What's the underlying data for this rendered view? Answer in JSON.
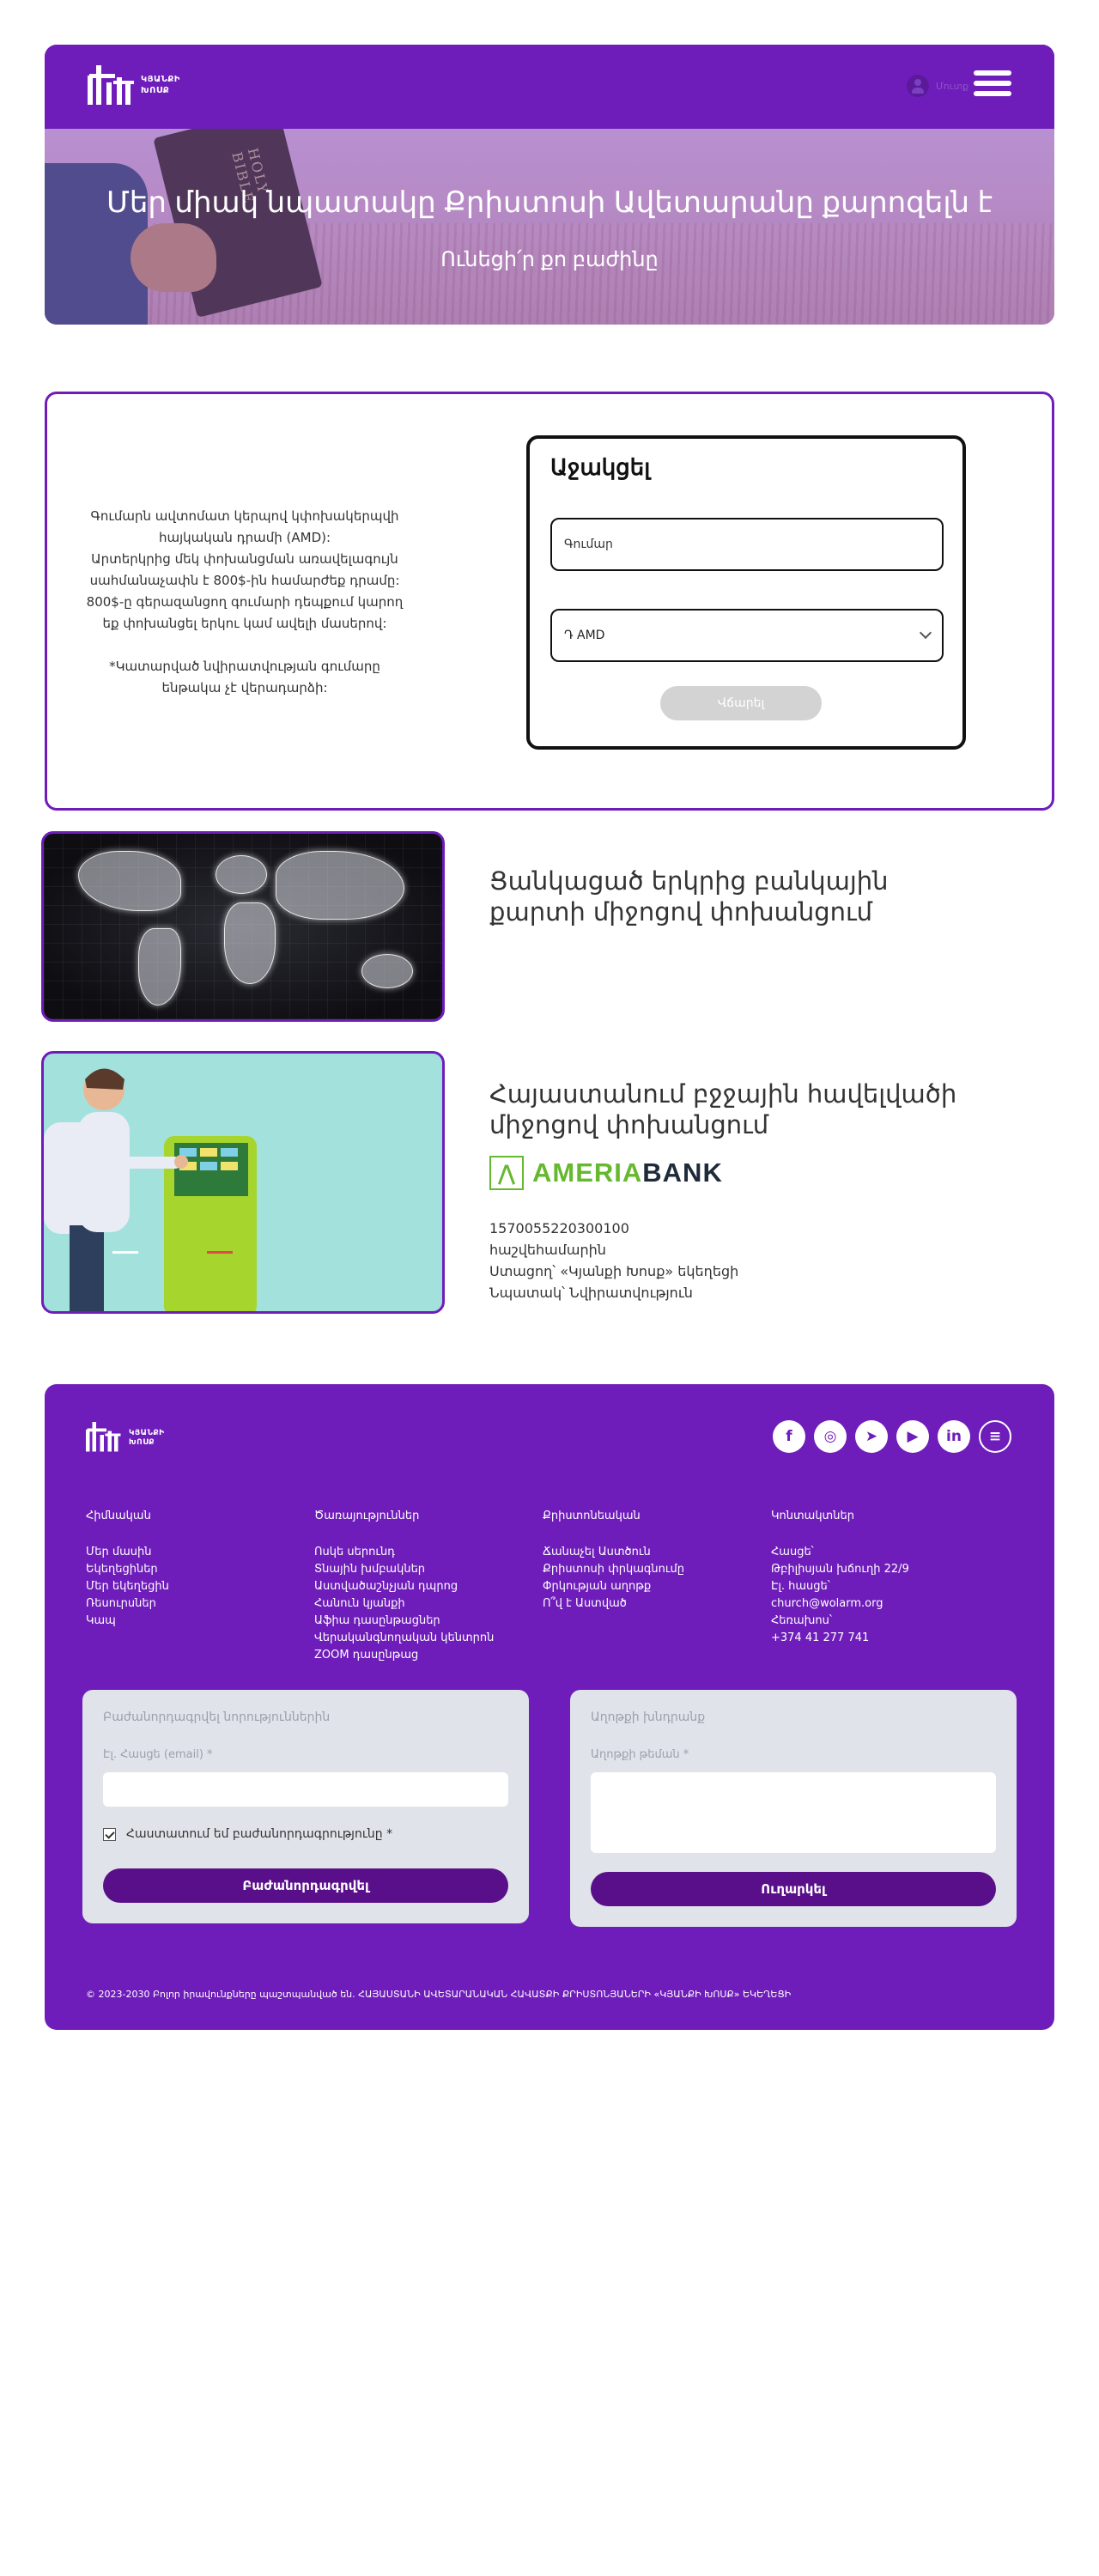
{
  "brand": {
    "logo_line1": "ԿՅԱՆՔԻ",
    "logo_line2": "ԽՈՍՔ"
  },
  "header": {
    "user_label": "Մուտք"
  },
  "hero": {
    "bible_label": "HOLY BIBLE",
    "title": "Մեր միակ նպատակը Քրիստոսի Ավետարանը քարոզելն է",
    "subtitle": "Ունեցի՛ր քո բաժինը"
  },
  "donate": {
    "info_lines": [
      "Գումարն ավտոմատ կերպով կփոխակերպվի",
      "հայկական դրամի (AMD):",
      "Արտերկրից մեկ փոխանցման առավելագույն",
      "սահմանաչափն է 800$-ին համարժեք դրամը:",
      "800$-ը գերազանցող գումարի դեպքում կարող",
      "եք փոխանցել երկու կամ ավելի մասերով:"
    ],
    "note": "*Կատարված նվիրատվության գումարը",
    "note2": "ենթակա չէ վերադարձի:",
    "form_title": "Աջակցել",
    "amount_placeholder": "Գումար",
    "currency_selected": "Դ AMD",
    "pay_button": "Վճարել"
  },
  "methods": {
    "card_title_1": "Ցանկացած երկրից բանկային",
    "card_title_2": "քարտի միջոցով փոխանցում",
    "bank_title_1": "Հայաստանում բջջային հավելվածի",
    "bank_title_2": "միջոցով փոխանցում",
    "bank_name_a": "AMERIA",
    "bank_name_b": "BANK",
    "account": "1570055220300100",
    "account_label": "հաշվեհամարին",
    "recipient": "Ստացող՝ «Կյանքի Խոսք» եկեղեցի",
    "purpose": "Նպատակ՝ Նվիրատվություն"
  },
  "footer": {
    "socials": [
      {
        "icon": "facebook-icon",
        "glyph": "f"
      },
      {
        "icon": "instagram-icon",
        "glyph": "◎"
      },
      {
        "icon": "telegram-icon",
        "glyph": "➤"
      },
      {
        "icon": "youtube-icon",
        "glyph": "▶"
      },
      {
        "icon": "linkedin-icon",
        "glyph": "in"
      },
      {
        "icon": "menu-icon",
        "glyph": "≡"
      }
    ],
    "col1": {
      "title": "Հիմնական",
      "links": [
        "Մեր մասին",
        "Եկեղեցիներ",
        "Մեր եկեղեցին",
        "Ռեսուրսներ",
        "Կապ"
      ]
    },
    "col2": {
      "title": "Ծառայություններ",
      "links": [
        "Ոսկե սերունդ",
        "Տնային խմբակներ",
        "Աստվածաշնչյան դպրոց",
        "Հանուն կյանքի",
        "Աֆիա դասընթացներ",
        "Վերականգնողական կենտրոն",
        "ZOOM դասընթաց"
      ]
    },
    "col3": {
      "title": "Քրիստոնեական",
      "links": [
        "Ճանաչել Աստծուն",
        "Քրիստոսի փրկագնումը",
        "Փրկության աղոթք",
        "Ո՞վ է Աստված"
      ]
    },
    "col4": {
      "title": "Կոնտակտներ",
      "links": [
        "Հասցե՝",
        "Թբիլիսյան խճուղի 22/9",
        "Էլ. հասցե՝",
        "church@wolarm.org",
        "Հեռախոս՝",
        "+374 41 277 741"
      ]
    },
    "newsletter": {
      "title": "Բաժանորդագրվել նորություններին",
      "email_label": "Էլ. Հասցե (email) *",
      "consent": "Հաստատում եմ բաժանորդագրությունը *",
      "button": "Բաժանորդագրվել"
    },
    "prayer": {
      "title": "Աղոթքի խնդրանք",
      "label": "Աղոթքի թեման *",
      "button": "Ուղարկել"
    },
    "copyright": "© 2023-2030 Բոլոր իրավունքները պաշտպանված են. ՀԱՅԱՍՏԱՆԻ ԱՎԵՏԱՐԱՆԱԿԱՆ ՀԱՎԱՏՔԻ ՔՐԻՍՏՈՆՅԱՆԵՐԻ «ԿՅԱՆՔԻ ԽՈՍՔ» ԵԿԵՂԵՑԻ"
  },
  "colors": {
    "brand_purple": "#6f1dba",
    "button_dark_purple": "#5a0f8a",
    "ameria_green": "#66b82e"
  }
}
